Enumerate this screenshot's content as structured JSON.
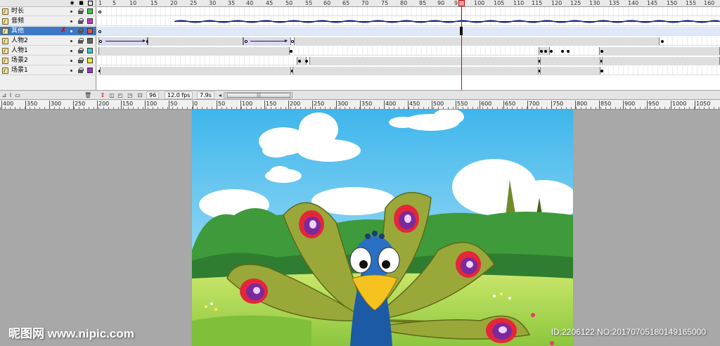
{
  "layers": [
    {
      "name": "时长",
      "color": "#33cc33",
      "selected": false
    },
    {
      "name": "音频",
      "color": "#cc33cc",
      "selected": false
    },
    {
      "name": "其他",
      "color": "#e05050",
      "selected": true
    },
    {
      "name": "人物2",
      "color": "#666666",
      "selected": false
    },
    {
      "name": "人物1",
      "color": "#33cccc",
      "selected": false
    },
    {
      "name": "场景2",
      "color": "#e8e833",
      "selected": false
    },
    {
      "name": "场景1",
      "color": "#9933cc",
      "selected": false
    }
  ],
  "frame_ruler": [
    "1",
    "5",
    "10",
    "15",
    "20",
    "25",
    "30",
    "35",
    "40",
    "45",
    "50",
    "55",
    "60",
    "65",
    "70",
    "75",
    "80",
    "85",
    "90",
    "95",
    "100",
    "105",
    "110",
    "115",
    "120",
    "125",
    "130",
    "135",
    "140",
    "145",
    "150",
    "155",
    "160"
  ],
  "footer": {
    "current_frame": "96",
    "fps": "12.0 fps",
    "elapsed": "7.9s"
  },
  "stage_ruler": [
    "400",
    "350",
    "300",
    "250",
    "200",
    "150",
    "100",
    "50",
    "0",
    "50",
    "100",
    "150",
    "200",
    "250",
    "300",
    "350",
    "400",
    "450",
    "500",
    "550",
    "600",
    "650",
    "700",
    "750",
    "800",
    "850",
    "900",
    "950",
    "1000",
    "1050"
  ],
  "watermark": {
    "site": "昵图网 www.nipic.com",
    "id": "ID:2206122 NO:20170705180149165000"
  },
  "colors": {
    "selected_layer": "#3c78c6",
    "playhead": "#d40000",
    "sky": "#5cc5f0",
    "grass": "#a6d64a"
  }
}
